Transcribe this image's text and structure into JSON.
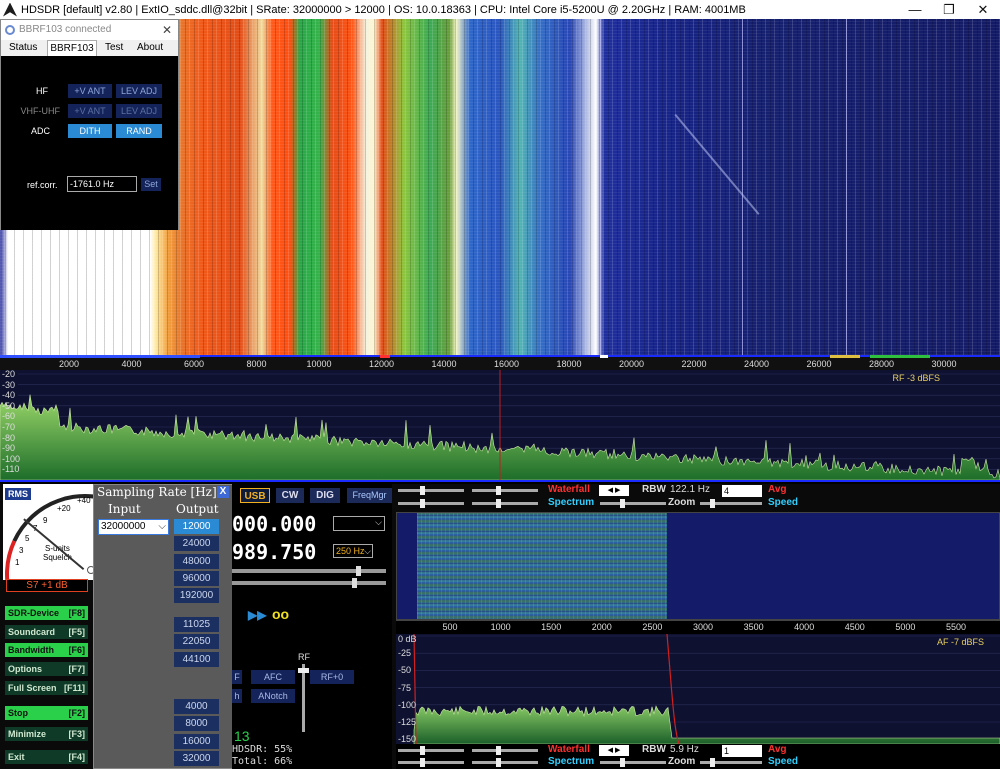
{
  "titlebar": {
    "text": "HDSDR  [default]  v2.80  |  ExtIO_sddc.dll@32bit  |  SRate: 32000000 > 12000  |  OS: 10.0.18363  |  CPU: Intel Core i5-5200U @ 2.20GHz  |  RAM: 4001MB",
    "minimize": "—",
    "restore": "❐",
    "close": "✕"
  },
  "waterfall": {
    "freq_ticks": [
      "2000",
      "4000",
      "6000",
      "8000",
      "10000",
      "12000",
      "14000",
      "16000",
      "18000",
      "20000",
      "22000",
      "24000",
      "26000",
      "28000",
      "30000"
    ]
  },
  "spectrum": {
    "db_labels": [
      "-20",
      "-30",
      "-40",
      "-50",
      "-60",
      "-70",
      "-80",
      "-90",
      "-100",
      "-110"
    ],
    "rf_level": "RF -3 dBFS"
  },
  "bbrf_dialog": {
    "title": "BBRF103 connected",
    "tabs": [
      "Status",
      "BBRF103",
      "Test",
      "About"
    ],
    "active_tab": "BBRF103",
    "rows": [
      {
        "label": "HF",
        "btn1": "+V ANT",
        "btn2": "LEV ADJ"
      },
      {
        "label": "VHF-UHF",
        "btn1": "+V ANT",
        "btn2": "LEV ADJ"
      },
      {
        "label": "ADC",
        "btn1": "DITH",
        "btn2": "RAND"
      }
    ],
    "refcorr_label": "ref.corr.",
    "refcorr_value": "-1761.0 Hz",
    "set_label": "Set"
  },
  "smeter": {
    "rms": "RMS",
    "scale_label": "S-units\nSquelch",
    "reading": "S7 +1 dB",
    "nums": [
      "+40",
      "+20",
      "9",
      "7",
      "5",
      "3",
      "1"
    ]
  },
  "side_buttons": [
    {
      "label": "SDR-Device",
      "key": "[F8]",
      "style": "green"
    },
    {
      "label": "Soundcard",
      "key": "[F5]",
      "style": "dark"
    },
    {
      "label": "Bandwidth",
      "key": "[F6]",
      "style": "green"
    },
    {
      "label": "Options",
      "key": "[F7]",
      "style": "dark"
    },
    {
      "label": "Full Screen",
      "key": "[F11]",
      "style": "dark"
    },
    {
      "label": "Stop",
      "key": "[F2]",
      "style": "green"
    },
    {
      "label": "Minimize",
      "key": "[F3]",
      "style": "dark"
    },
    {
      "label": "Exit",
      "key": "[F4]",
      "style": "dark"
    }
  ],
  "sampling_rate": {
    "title": "Sampling Rate [Hz]",
    "close": "X",
    "input_label": "Input",
    "output_label": "Output",
    "input_value": "32000000",
    "outputs_a": [
      "12000",
      "24000",
      "48000",
      "96000",
      "192000"
    ],
    "outputs_b": [
      "11025",
      "22050",
      "44100"
    ],
    "outputs_c": [
      "4000",
      "8000",
      "16000",
      "32000"
    ],
    "selected_output": "12000"
  },
  "centre": {
    "modes": [
      "USB",
      "CW",
      "DIG"
    ],
    "active_mode": "USB",
    "freqmgr": "FreqMgr",
    "lo_freq": "000.000",
    "tune_freq": "989.750",
    "step": "250 Hz",
    "play_icons": "▶▶",
    "rec_icon": "oo",
    "btn_f": "F",
    "btn_afc": "AFC",
    "btn_h": "h",
    "btn_anotch": "ANotch",
    "btn_rf0": "RF+0",
    "rf_label": "RF",
    "num13": "13",
    "stat1": "HDSDR:  55%",
    "stat2": "Total:  66%"
  },
  "right_controls": {
    "waterfall_label": "Waterfall",
    "spectrum_label": "Spectrum",
    "rbw_label": "RBW",
    "rbw_top": "122.1 Hz",
    "avg_top": "4",
    "avg_label": "Avg",
    "zoom_label": "Zoom",
    "speed_label": "Speed",
    "rbw_bottom": "5.9 Hz",
    "avg_bottom": "1"
  },
  "af": {
    "freq_ticks": [
      "500",
      "1000",
      "1500",
      "2000",
      "2500",
      "3000",
      "3500",
      "4000",
      "4500",
      "5000",
      "5500"
    ],
    "db_labels": [
      "0 dB",
      "-25",
      "-50",
      "-75",
      "-100",
      "-125",
      "-150"
    ],
    "af_level": "AF -7 dBFS"
  },
  "colors": {
    "accent": "#2a8ad4",
    "green_btn": "#2ad04a",
    "waterfall_label": "#ff3030",
    "spectrum_label": "#30d0ff",
    "lo_display": "#ffffff",
    "band_line": "#1a2bff"
  }
}
